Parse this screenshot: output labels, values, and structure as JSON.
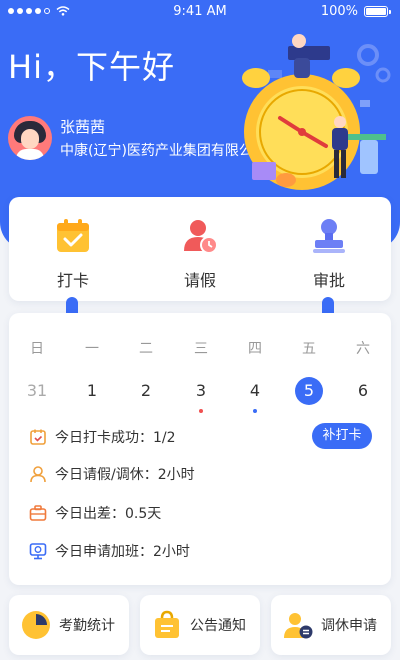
{
  "status_bar": {
    "time": "9:41 AM",
    "battery": "100%"
  },
  "header": {
    "greeting": "Hi，下午好",
    "user_name": "张茜茜",
    "company": "中康(辽宁)医药产业集团有限公司"
  },
  "quick_actions": [
    {
      "label": "打卡",
      "icon": "clipboard-check-icon"
    },
    {
      "label": "请假",
      "icon": "person-clock-icon"
    },
    {
      "label": "审批",
      "icon": "stamp-icon"
    }
  ],
  "calendar": {
    "weekdays": [
      "日",
      "一",
      "二",
      "三",
      "四",
      "五",
      "六"
    ],
    "dates": [
      "31",
      "1",
      "2",
      "3",
      "4",
      "5",
      "6"
    ],
    "selected_index": 5,
    "muted_index": 0,
    "markers": [
      {
        "index": 3,
        "color": "#f05050"
      },
      {
        "index": 4,
        "color": "#3a6cf6"
      }
    ]
  },
  "summary": {
    "checkin": "今日打卡成功：1/2",
    "leave": "今日请假/调休：2小时",
    "business_trip": "今日出差：0.5天",
    "overtime": "今日申请加班：2小时",
    "supplement_button": "补打卡"
  },
  "bottom_menu": [
    {
      "label": "考勤统计",
      "icon": "pie-chart-icon"
    },
    {
      "label": "公告通知",
      "icon": "bag-document-icon"
    },
    {
      "label": "调休申请",
      "icon": "person-swap-icon"
    }
  ],
  "colors": {
    "primary": "#3a6cf6",
    "accent_yellow": "#ffc233",
    "accent_red": "#f05a5a"
  }
}
